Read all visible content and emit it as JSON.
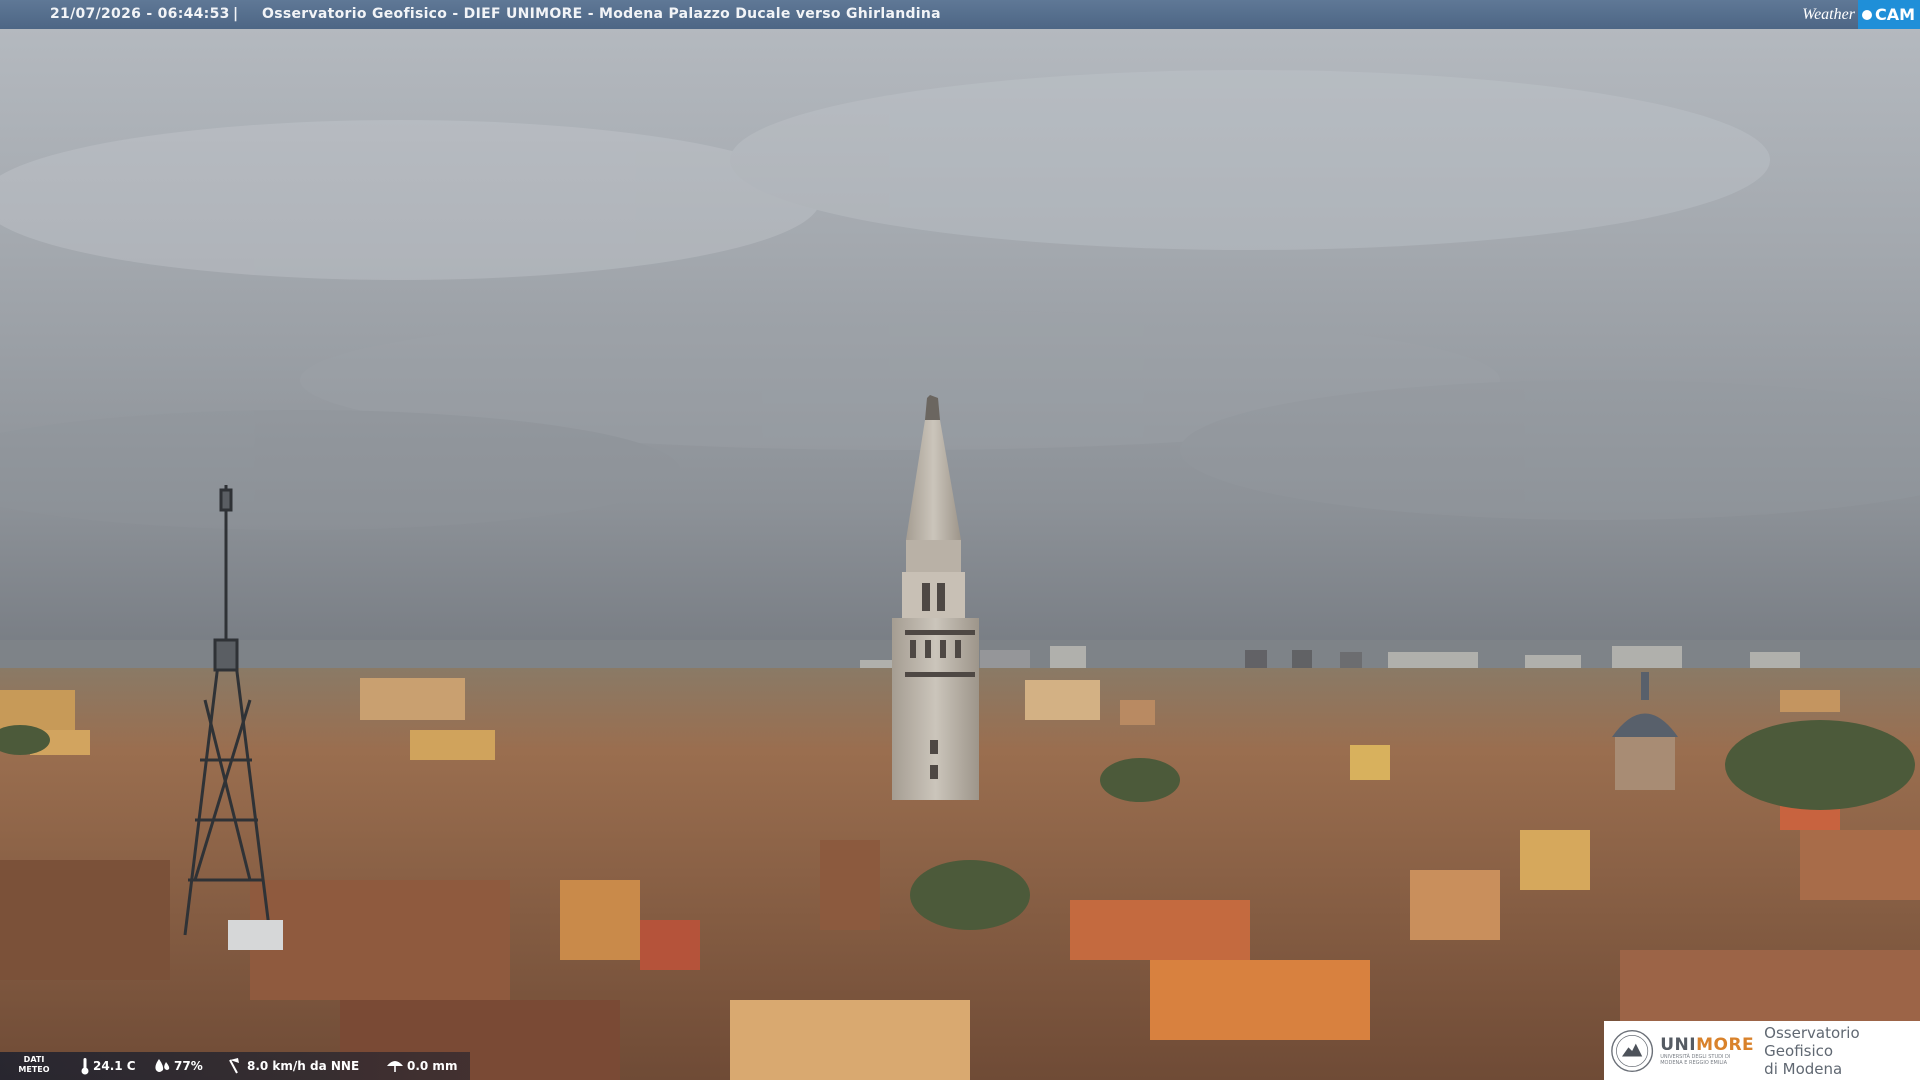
{
  "header": {
    "timestamp": "21/07/2026 - 06:44:53",
    "separator": "|",
    "title": "Osservatorio Geofisico - DIEF UNIMORE - Modena Palazzo Ducale verso Ghirlandina"
  },
  "brand": {
    "weather": "Weather",
    "cam": "CAM"
  },
  "meteo": {
    "label_line1": "DATI",
    "label_line2": "METEO",
    "temperature": "24.1 C",
    "humidity": "77%",
    "wind": "8.0 km/h da NNE",
    "rain": "0.0 mm"
  },
  "logo": {
    "uni": "UNI",
    "more": "MORE",
    "university_line1": "UNIVERSITÀ DEGLI STUDI DI",
    "university_line2": "MODENA E REGGIO EMILIA",
    "observatory_line1": "Osservatorio Geofisico",
    "observatory_line2": "di Modena"
  },
  "colors": {
    "banner": "#56708f",
    "cam_badge": "#1f8fd8",
    "unimore_orange": "#d9822b"
  },
  "icons": [
    "thermometer-icon",
    "humidity-icon",
    "wind-icon",
    "rain-gauge-icon",
    "university-seal-icon"
  ]
}
